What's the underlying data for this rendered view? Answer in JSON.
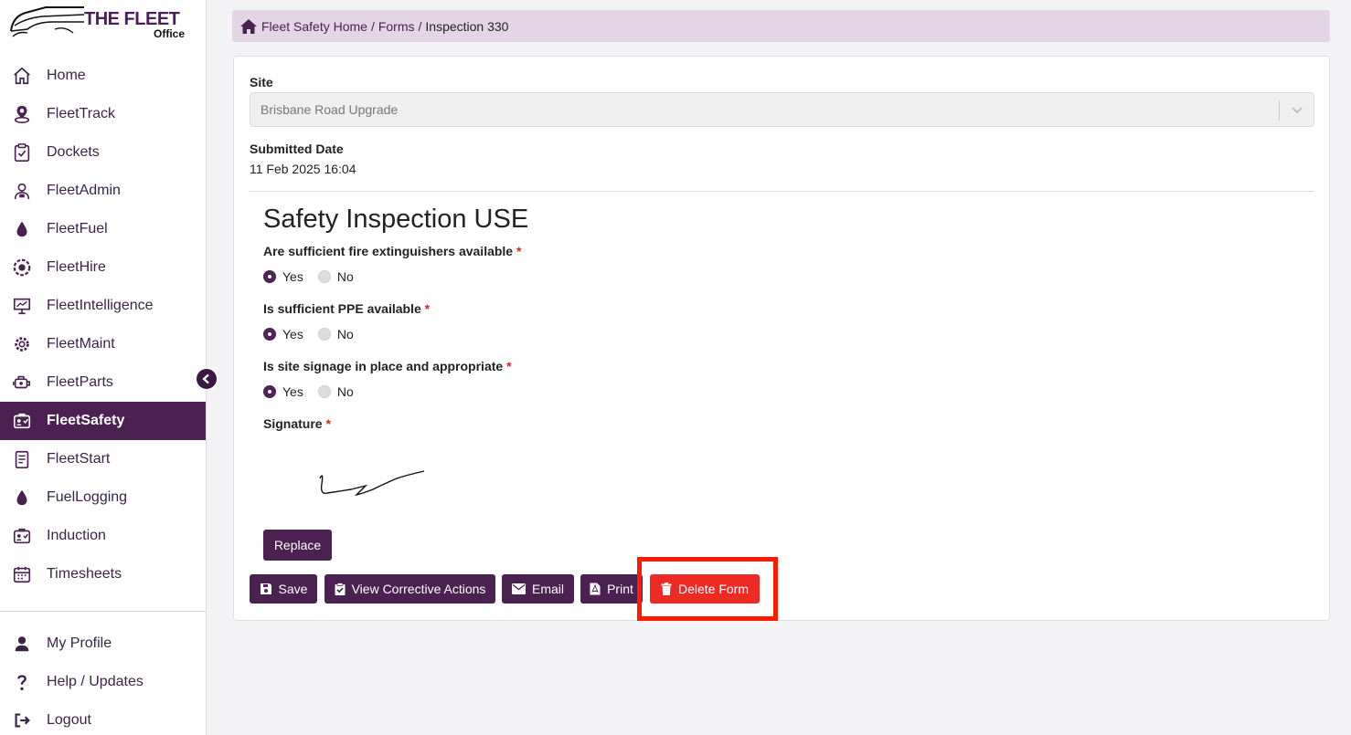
{
  "logo": {
    "brand": "THE FLEET",
    "sub": "Office"
  },
  "sidebar": {
    "items": [
      {
        "label": "Home",
        "icon": "home-icon"
      },
      {
        "label": "FleetTrack",
        "icon": "location-pin-icon"
      },
      {
        "label": "Dockets",
        "icon": "clipboard-check-icon"
      },
      {
        "label": "FleetAdmin",
        "icon": "user-admin-icon"
      },
      {
        "label": "FleetFuel",
        "icon": "fuel-drop-icon"
      },
      {
        "label": "FleetHire",
        "icon": "hire-wheel-icon"
      },
      {
        "label": "FleetIntelligence",
        "icon": "presentation-chart-icon"
      },
      {
        "label": "FleetMaint",
        "icon": "gear-icon"
      },
      {
        "label": "FleetParts",
        "icon": "engine-icon"
      },
      {
        "label": "FleetSafety",
        "icon": "safety-id-icon"
      },
      {
        "label": "FleetStart",
        "icon": "checklist-icon"
      },
      {
        "label": "FuelLogging",
        "icon": "fuel-drop-icon"
      },
      {
        "label": "Induction",
        "icon": "induction-id-icon"
      },
      {
        "label": "Timesheets",
        "icon": "calendar-icon"
      }
    ],
    "active_index": 9,
    "bottom": [
      {
        "label": "My Profile",
        "icon": "user-icon"
      },
      {
        "label": "Help / Updates",
        "icon": "question-icon"
      },
      {
        "label": "Logout",
        "icon": "logout-icon"
      }
    ]
  },
  "breadcrumb": {
    "home": "Fleet Safety Home",
    "sep1": "/",
    "forms": "Forms",
    "sep2": "/",
    "current": "Inspection 330"
  },
  "form": {
    "site_label": "Site",
    "site_value": "Brisbane Road Upgrade",
    "submitted_label": "Submitted Date",
    "submitted_value": "11 Feb 2025 16:04",
    "title": "Safety Inspection USE",
    "questions": [
      {
        "label": "Are sufficient fire extinguishers available",
        "required": "*",
        "yes": "Yes",
        "no": "No",
        "selected": "Yes"
      },
      {
        "label": "Is sufficient PPE available",
        "required": "*",
        "yes": "Yes",
        "no": "No",
        "selected": "Yes"
      },
      {
        "label": "Is site signage in place and appropriate",
        "required": "*",
        "yes": "Yes",
        "no": "No",
        "selected": "Yes"
      }
    ],
    "signature_label": "Signature",
    "signature_required": "*",
    "replace_label": "Replace"
  },
  "actions": {
    "save": "Save",
    "view_corrective": "View Corrective Actions",
    "email": "Email",
    "print": "Print",
    "delete": "Delete Form"
  },
  "colors": {
    "primary": "#4a2150",
    "breadcrumb_bg": "#e3d5e6",
    "danger": "#ee2a24",
    "highlight": "#ff1a00"
  }
}
